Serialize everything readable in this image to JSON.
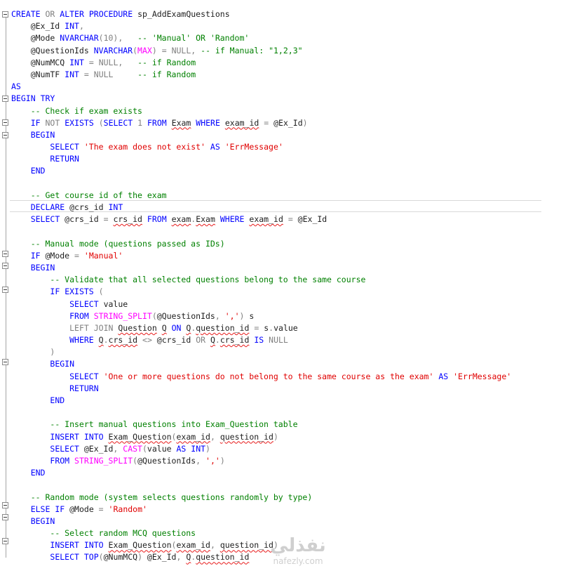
{
  "editor": {
    "lines": [
      "CREATE OR ALTER PROCEDURE sp_AddExamQuestions",
      "    @Ex_Id INT,",
      "    @Mode NVARCHAR(10),   -- 'Manual' OR 'Random'",
      "    @QuestionIds NVARCHAR(MAX) = NULL, -- if Manual: \"1,2,3\"",
      "    @NumMCQ INT = NULL,   -- if Random",
      "    @NumTF INT = NULL     -- if Random",
      "AS",
      "BEGIN TRY",
      "    -- Check if exam exists",
      "    IF NOT EXISTS (SELECT 1 FROM Exam WHERE exam_id = @Ex_Id)",
      "    BEGIN",
      "        SELECT 'The exam does not exist' AS 'ErrMessage'",
      "        RETURN",
      "    END",
      "",
      "    -- Get course id of the exam",
      "    DECLARE @crs_id INT",
      "    SELECT @crs_id = crs_id FROM exam.Exam WHERE exam_id = @Ex_Id",
      "",
      "    -- Manual mode (questions passed as IDs)",
      "    IF @Mode = 'Manual'",
      "    BEGIN",
      "        -- Validate that all selected questions belong to the same course",
      "        IF EXISTS (",
      "            SELECT value",
      "            FROM STRING_SPLIT(@QuestionIds, ',') s",
      "            LEFT JOIN Question Q ON Q.question_id = s.value",
      "            WHERE Q.crs_id <> @crs_id OR Q.crs_id IS NULL",
      "        )",
      "        BEGIN",
      "            SELECT 'One or more questions do not belong to the same course as the exam' AS 'ErrMessage'",
      "            RETURN",
      "        END",
      "",
      "        -- Insert manual questions into Exam_Question table",
      "        INSERT INTO Exam_Question(exam_id, question_id)",
      "        SELECT @Ex_Id, CAST(value AS INT)",
      "        FROM STRING_SPLIT(@QuestionIds, ',')",
      "    END",
      "",
      "    -- Random mode (system selects questions randomly by type)",
      "    ELSE IF @Mode = 'Random'",
      "    BEGIN",
      "        -- Select random MCQ questions",
      "        INSERT INTO Exam_Question(exam_id, question_id)",
      "        SELECT TOP(@NumMCQ) @Ex_Id, Q.question_id"
    ]
  },
  "watermark": {
    "arabic": "نفذلي",
    "latin": "nafezly.com"
  },
  "colors": {
    "keyword": "#0000ff",
    "function": "#ff00ff",
    "string": "#e00000",
    "comment": "#008000",
    "operator": "#808080",
    "squiggle": "#e81b1b"
  }
}
